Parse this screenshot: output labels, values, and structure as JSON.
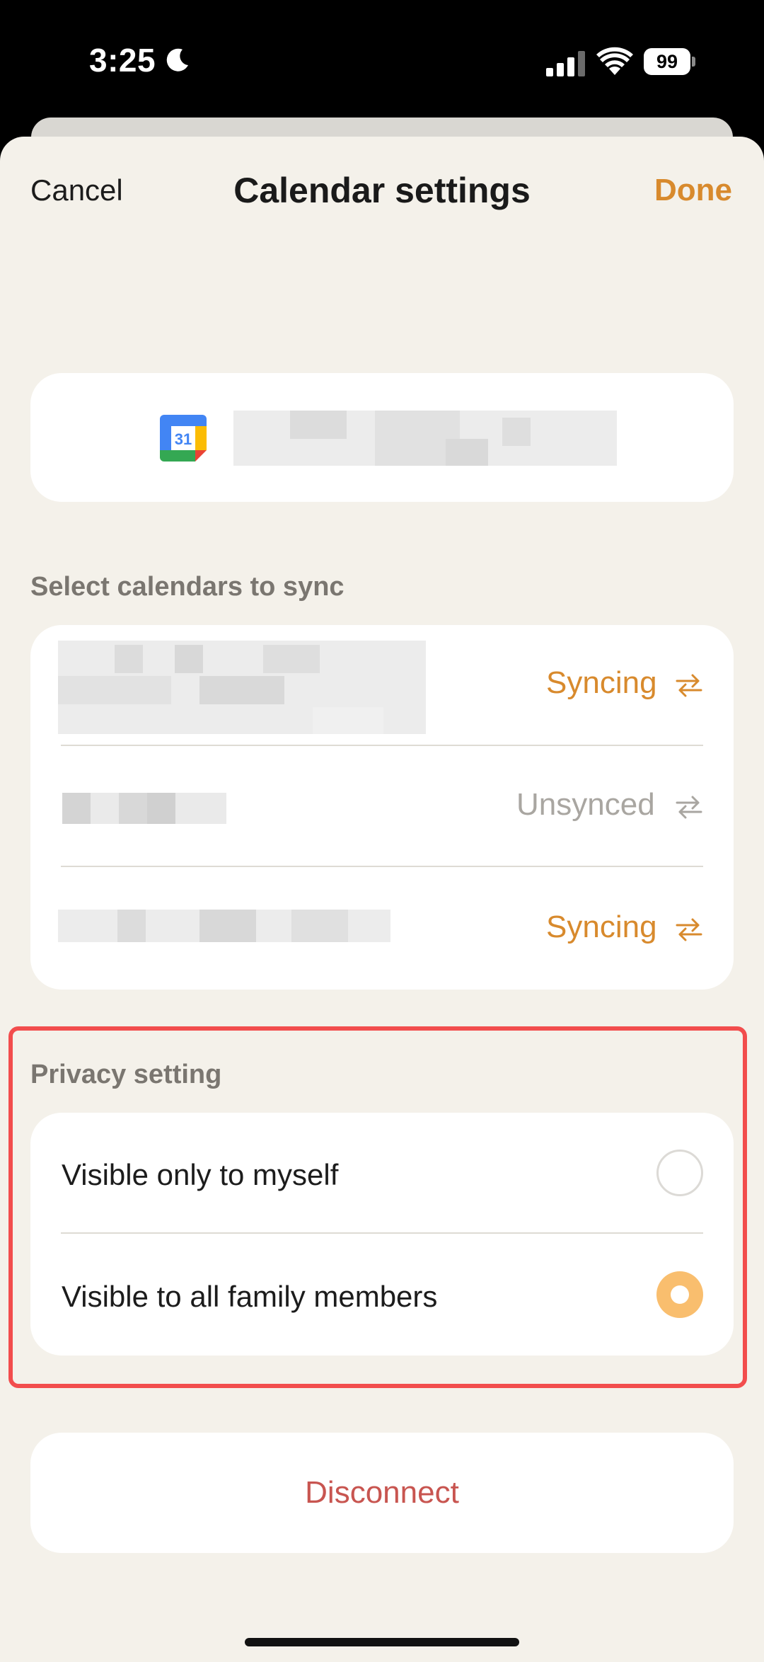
{
  "status_bar": {
    "time": "3:25",
    "battery": "99",
    "icons": [
      "moon-icon",
      "signal-icon",
      "wifi-icon",
      "battery-icon"
    ]
  },
  "header": {
    "cancel_label": "Cancel",
    "title": "Calendar settings",
    "done_label": "Done"
  },
  "account": {
    "icon": "google-calendar-icon",
    "icon_text": "31",
    "name_redacted": true
  },
  "calendars_section": {
    "label": "Select calendars to sync",
    "items": [
      {
        "name_redacted": true,
        "status": "Syncing",
        "icon": "sync-arrows-icon"
      },
      {
        "name_redacted": true,
        "status": "Unsynced",
        "icon": "sync-arrows-icon"
      },
      {
        "name_redacted": true,
        "status": "Syncing",
        "icon": "sync-arrows-icon"
      }
    ]
  },
  "privacy_section": {
    "label": "Privacy setting",
    "options": [
      {
        "label": "Visible only to myself",
        "selected": false
      },
      {
        "label": "Visible to all family members",
        "selected": true
      }
    ]
  },
  "disconnect_label": "Disconnect",
  "colors": {
    "accent": "#d88a2d",
    "radio_selected": "#f9be6e",
    "disconnect": "#c85550",
    "background": "#f4f1ea",
    "highlight_border": "#f24d4d"
  }
}
